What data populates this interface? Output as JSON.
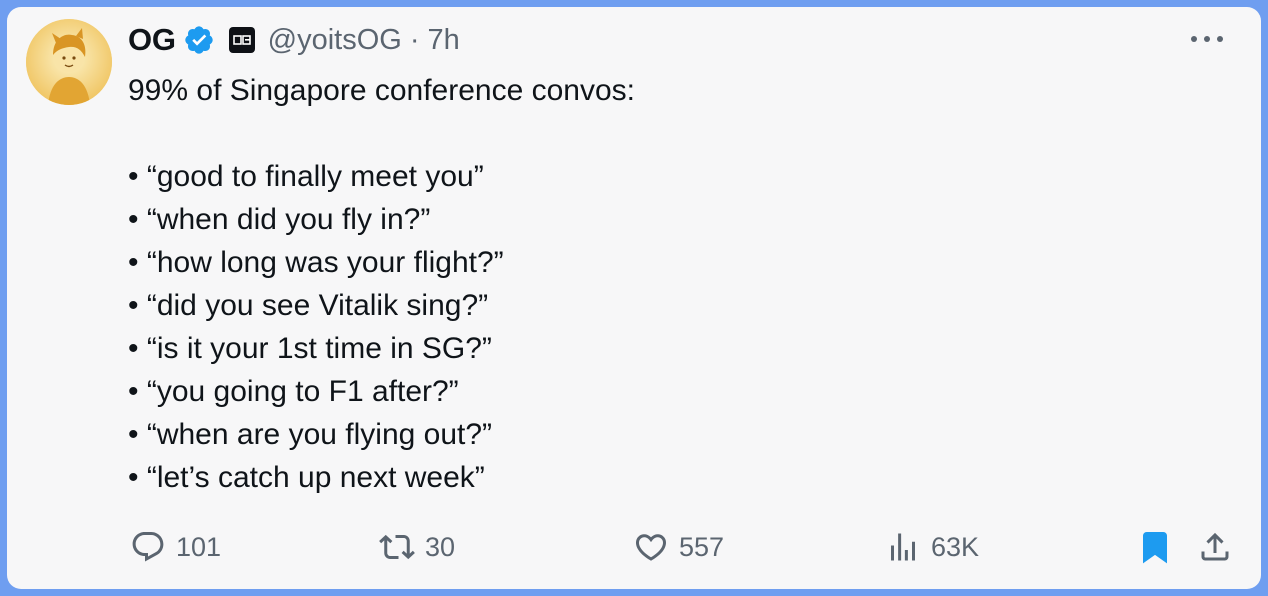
{
  "post": {
    "author": {
      "display_name": "OG",
      "handle": "@yoitsOG",
      "separator": "·",
      "time": "7h",
      "affiliation_badge": "OG"
    },
    "text_intro": "99% of Singapore conference convos:",
    "lines": [
      "• “good to finally meet you”",
      "• “when did you fly in?”",
      "• “how long was your flight?”",
      "• “did you see Vitalik sing?”",
      "• “is it your 1st time in SG?”",
      "• “you going to F1 after?”",
      "• “when are you flying out?”",
      "• “let’s catch up next week”"
    ],
    "metrics": {
      "replies": "101",
      "reposts": "30",
      "likes": "557",
      "views": "63K"
    },
    "icons": {
      "reply": "reply-icon",
      "repost": "repost-icon",
      "like": "heart-icon",
      "views": "analytics-icon",
      "bookmark": "bookmark-icon",
      "share": "share-icon",
      "more": "more-icon",
      "verified": "verified-badge-icon"
    },
    "colors": {
      "frame": "#6f9ef0",
      "card": "#f7f7f8",
      "text": "#0f1419",
      "muted": "#5b6570",
      "accent": "#1d9bf0"
    }
  }
}
